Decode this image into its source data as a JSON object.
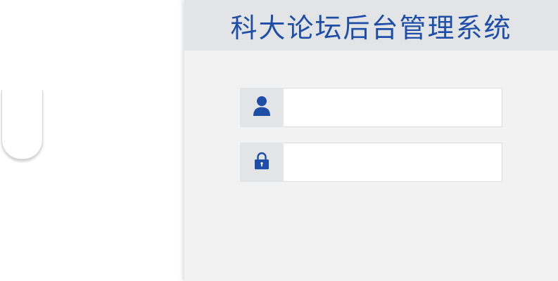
{
  "login": {
    "title": "科大论坛后台管理系统",
    "username": {
      "value": "",
      "placeholder": "",
      "icon": "user-icon"
    },
    "password": {
      "value": "",
      "placeholder": "",
      "icon": "lock-icon"
    }
  },
  "colors": {
    "accent": "#1e4ea8",
    "panel_bg": "#f2f2f2",
    "header_bg": "#e3e4e6",
    "icon_box_bg": "#e3e4e6"
  }
}
